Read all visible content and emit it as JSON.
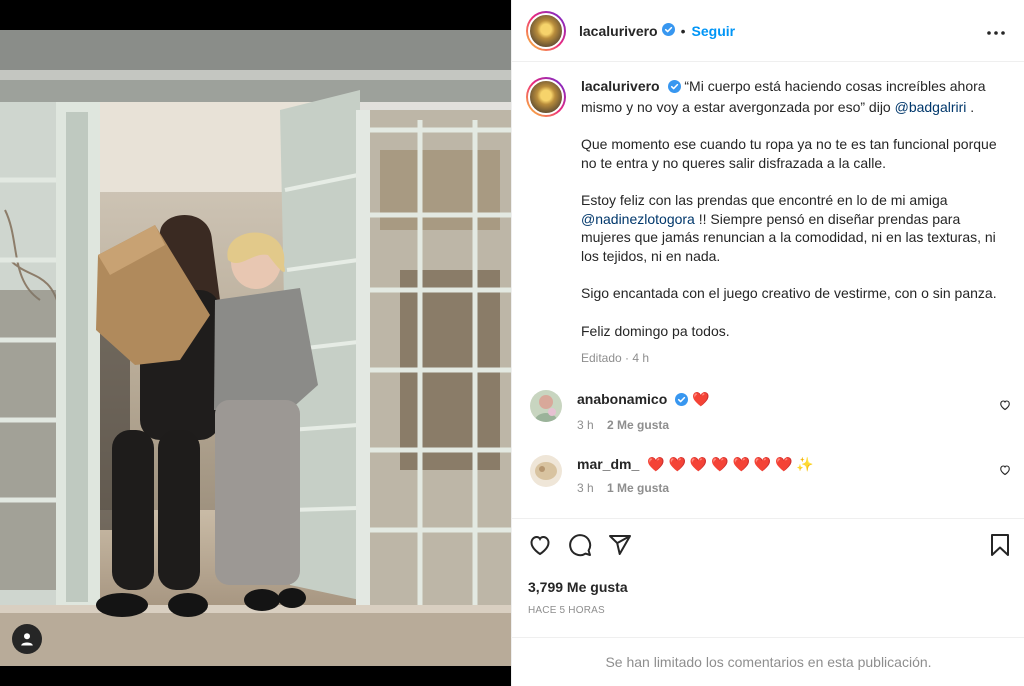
{
  "post": {
    "username": "lacalurivero",
    "follow_label": "Seguir",
    "separator": "•"
  },
  "caption": {
    "username": "lacalurivero",
    "p1_text": "“Mi cuerpo está haciendo cosas increíbles ahora mismo y no voy a estar avergonzada por eso” dijo ",
    "p1_mention": "@badgalriri",
    "p1_end": " .",
    "p2": "Que momento ese cuando tu ropa ya no te es tan funcional porque no te entra y no queres salir disfrazada a la calle.",
    "p3_start": "Estoy feliz con las prendas que encontré en lo de mi amiga ",
    "p3_mention": "@nadinezlotogora",
    "p3_end": " !! Siempre pensó en diseñar prendas para mujeres que jamás renuncian a la comodidad, ni en las texturas, ni los tejidos, ni en nada.",
    "p4": "Sigo encantada con el juego creativo de vestirme, con o sin panza.",
    "p5": "Feliz domingo pa todos.",
    "edited_meta": "Editado · 4 h"
  },
  "comments": [
    {
      "username": "anabonamico",
      "text": "❤️",
      "time": "3 h",
      "likes": "2 Me gusta",
      "verified": true
    },
    {
      "username": "mar_dm_",
      "text": "❤️ ❤️ ❤️ ❤️ ❤️ ❤️ ❤️ ✨",
      "time": "3 h",
      "likes": "1 Me gusta",
      "verified": false
    }
  ],
  "engagement": {
    "likes": "3,799 Me gusta",
    "time_ago": "HACE 5 HORAS",
    "comments_limited": "Se han limitado los comentarios en esta publicación."
  },
  "icons": {
    "like": "heart-icon",
    "comment": "comment-icon",
    "share": "share-icon",
    "save": "bookmark-icon",
    "more": "more-options-icon",
    "tagged_user": "user-tag-icon",
    "verified": "verified-badge-icon"
  },
  "colors": {
    "accent": "#0095f6",
    "verified": "#3897f0",
    "mention": "#00376b",
    "muted": "#8e8e8e"
  }
}
